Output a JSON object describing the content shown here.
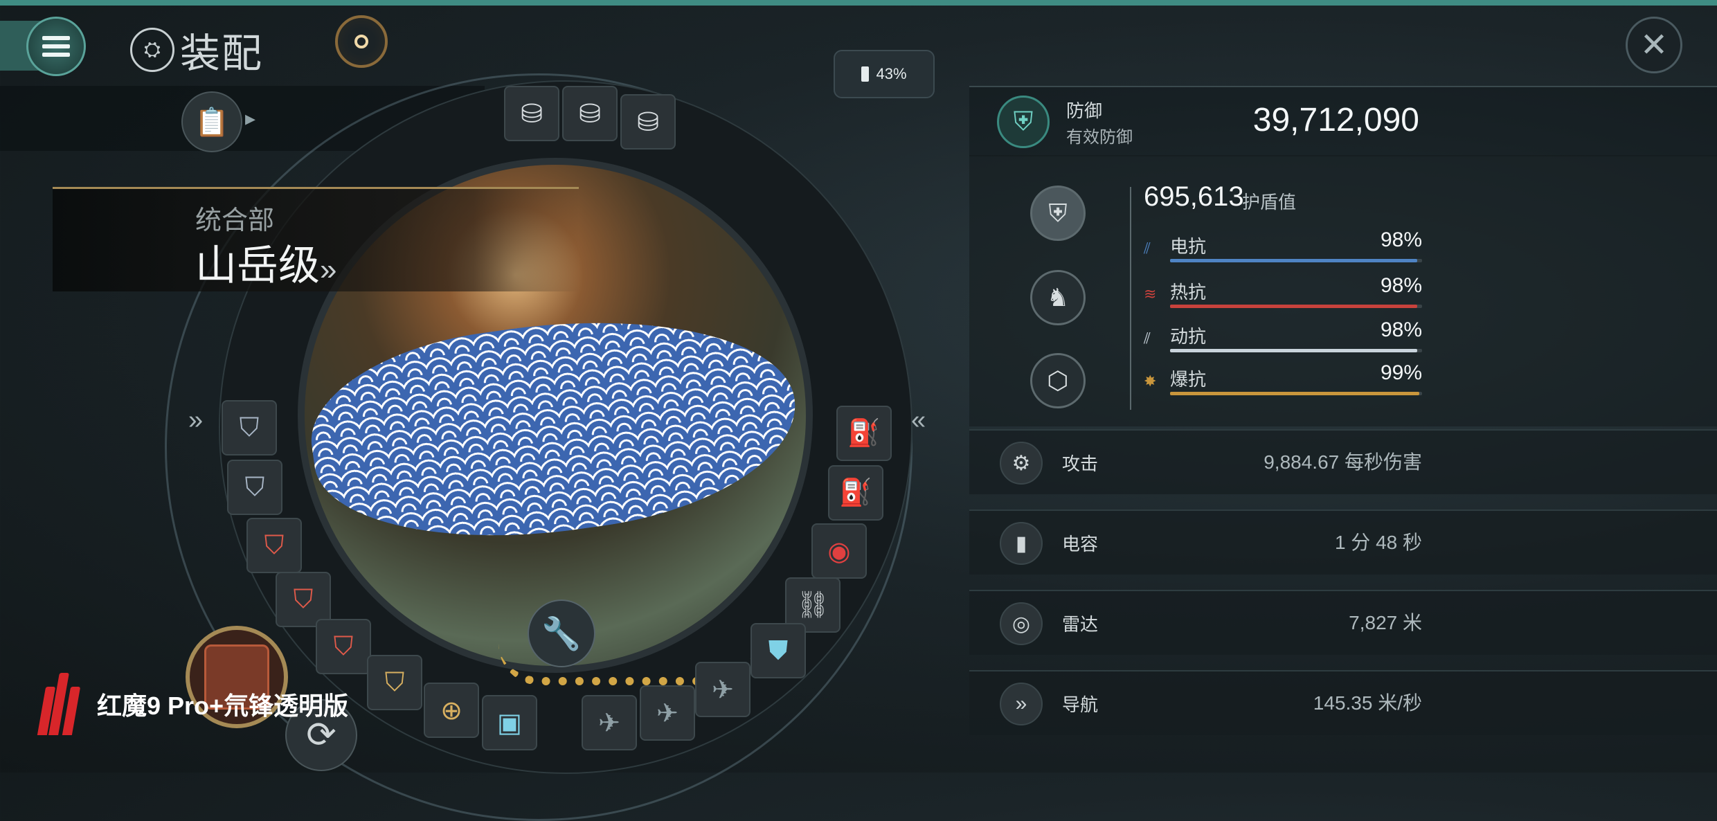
{
  "header": {
    "menu_icon": "hamburger-menu-icon",
    "title_icon": "ship-fitting-icon",
    "title": "装配",
    "battery": "43%",
    "close_icon": "close-icon"
  },
  "ship": {
    "faction": "统合部",
    "class": "山岳级",
    "class_arrow": "»"
  },
  "slots": {
    "high_icon": "turret-module-icon",
    "mid_icon": "shield-booster-icon",
    "low_icon": "armor-plate-icon",
    "rig_icon": "rig-module-icon",
    "left_arrow": "»",
    "right_arrow": "«"
  },
  "defense": {
    "label": "防御",
    "sub_label": "有效防御",
    "value": "39,712,090",
    "shield_value": "695,613",
    "shield_label": "护盾值",
    "resists": [
      {
        "name": "电抗",
        "value": "98%",
        "percent": 98,
        "color": "#4f84c4"
      },
      {
        "name": "热抗",
        "value": "98%",
        "percent": 98,
        "color": "#c8423c"
      },
      {
        "name": "动抗",
        "value": "98%",
        "percent": 98,
        "color": "#c9d4dc"
      },
      {
        "name": "爆抗",
        "value": "99%",
        "percent": 99,
        "color": "#c9963c"
      }
    ]
  },
  "stats": [
    {
      "name": "攻击",
      "value": "9,884.67 每秒伤害",
      "icon": "turret-icon"
    },
    {
      "name": "电容",
      "value": "1 分 48 秒",
      "icon": "capacitor-icon"
    },
    {
      "name": "雷达",
      "value": "7,827 米",
      "icon": "radar-icon"
    },
    {
      "name": "导航",
      "value": "145.35 米/秒",
      "icon": "navigation-icon"
    }
  ],
  "watermark": {
    "brand": "红魔9 Pro+氘锋透明版"
  }
}
